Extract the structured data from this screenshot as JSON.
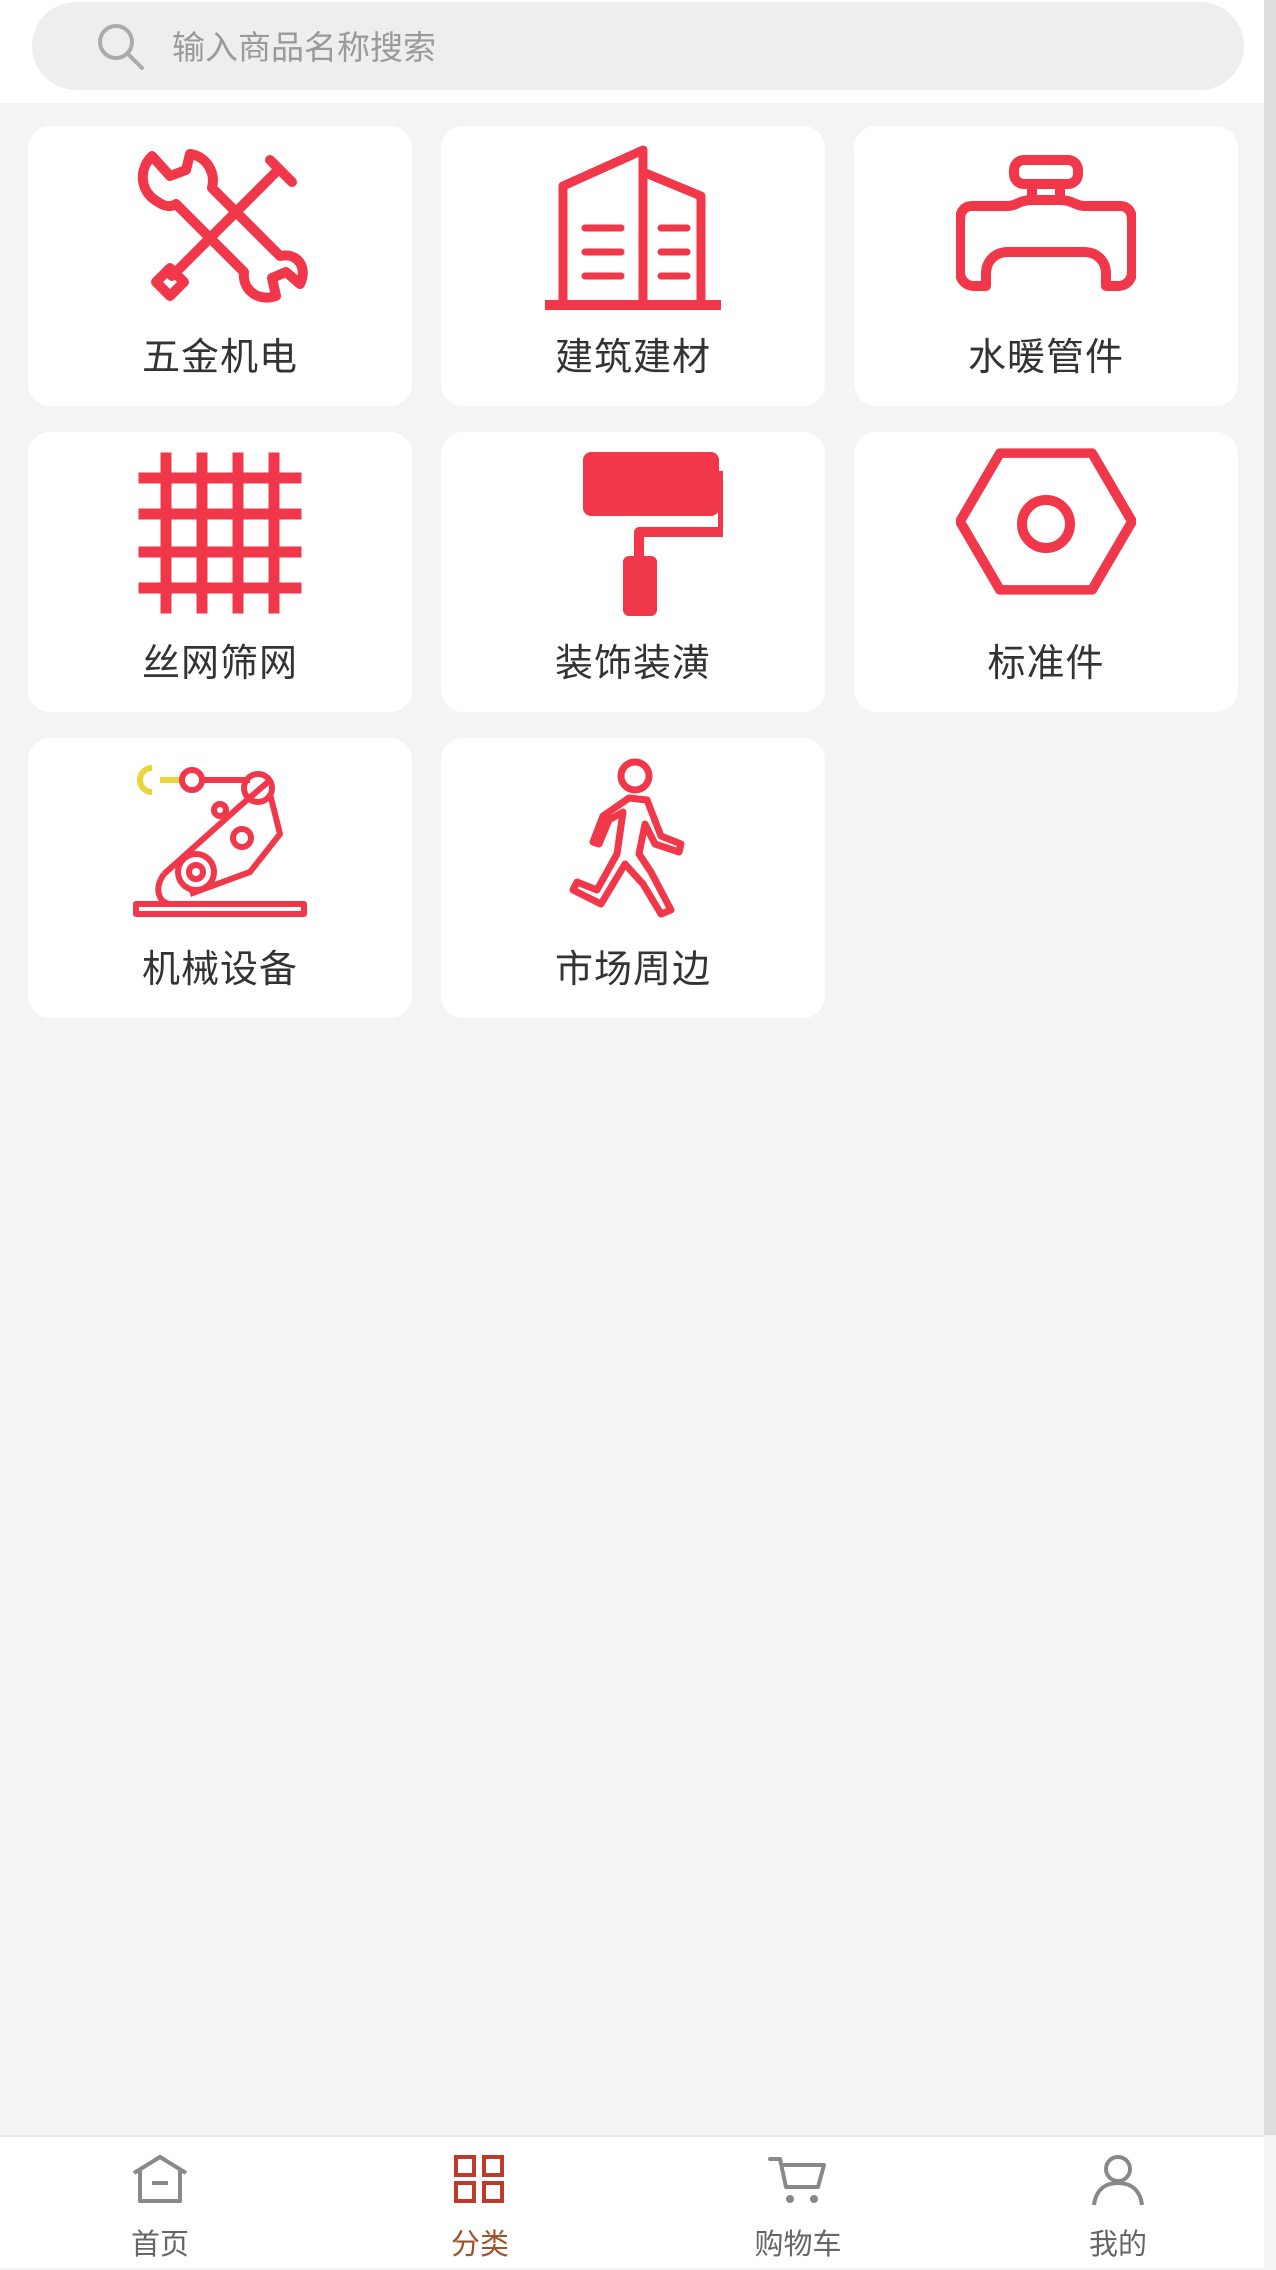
{
  "search": {
    "placeholder": "输入商品名称搜索"
  },
  "categories": [
    {
      "label": "五金机电",
      "icon": "tools-icon"
    },
    {
      "label": "建筑建材",
      "icon": "building-icon"
    },
    {
      "label": "水暖管件",
      "icon": "pipe-valve-icon"
    },
    {
      "label": "丝网筛网",
      "icon": "wire-mesh-icon"
    },
    {
      "label": "装饰装潢",
      "icon": "paint-roller-icon"
    },
    {
      "label": "标准件",
      "icon": "hex-nut-icon"
    },
    {
      "label": "机械设备",
      "icon": "robot-arm-icon"
    },
    {
      "label": "市场周边",
      "icon": "walking-person-icon"
    }
  ],
  "tabbar": {
    "items": [
      {
        "label": "首页",
        "icon": "home-icon",
        "active": false
      },
      {
        "label": "分类",
        "icon": "category-grid-icon",
        "active": true
      },
      {
        "label": "购物车",
        "icon": "cart-icon",
        "active": false
      },
      {
        "label": "我的",
        "icon": "user-icon",
        "active": false
      }
    ]
  },
  "colors": {
    "accent": "#f0384a",
    "active_tab": "#a0522d",
    "robot_claw": "#e8d63a",
    "background": "#f4f4f4"
  }
}
